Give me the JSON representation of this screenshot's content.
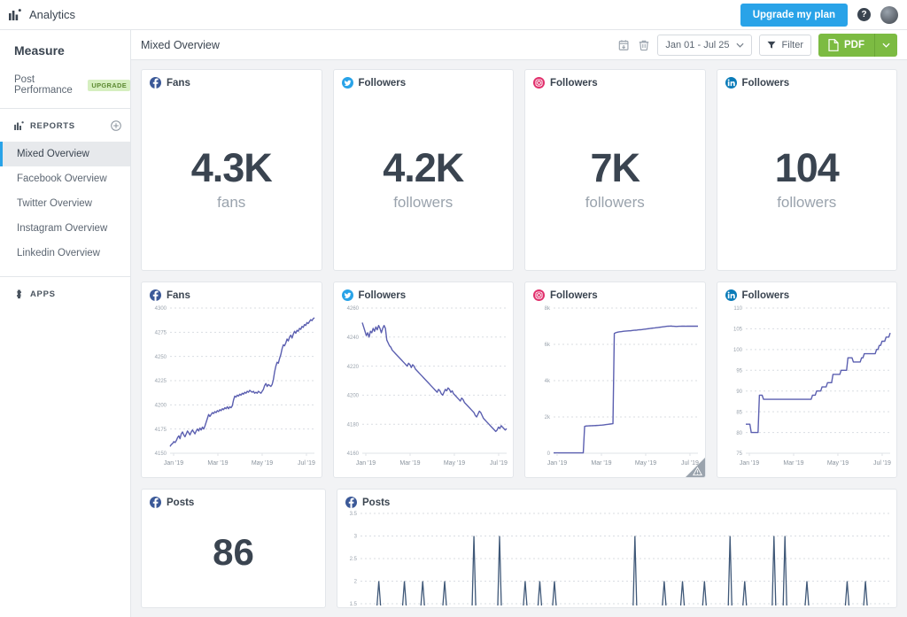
{
  "topbar": {
    "brand": "Analytics",
    "upgrade_label": "Upgrade my plan",
    "help_label": "?"
  },
  "sidebar": {
    "measure_title": "Measure",
    "post_performance": {
      "label": "Post Performance",
      "badge": "UPGRADE"
    },
    "reports_header": "REPORTS",
    "reports": [
      {
        "label": "Mixed Overview",
        "active": true
      },
      {
        "label": "Facebook Overview",
        "active": false
      },
      {
        "label": "Twitter Overview",
        "active": false
      },
      {
        "label": "Instagram Overview",
        "active": false
      },
      {
        "label": "Linkedin Overview",
        "active": false
      }
    ],
    "apps_header": "APPS"
  },
  "toolbar": {
    "title": "Mixed Overview",
    "date_range": "Jan 01 - Jul 25",
    "filter_label": "Filter",
    "pdf_label": "PDF"
  },
  "colors": {
    "facebook": "#3b5998",
    "twitter": "#29a3e8",
    "instagram": "#e1306c",
    "linkedin": "#0a7bb8",
    "accent_blue": "#29a3e8",
    "accent_green": "#7cbb42",
    "line_purple": "#5b5fb0",
    "spike_blue": "#3f5878"
  },
  "summary_cards": [
    {
      "network": "facebook",
      "title": "Fans",
      "value": "4.3K",
      "unit": "fans"
    },
    {
      "network": "twitter",
      "title": "Followers",
      "value": "4.2K",
      "unit": "followers"
    },
    {
      "network": "instagram",
      "title": "Followers",
      "value": "7K",
      "unit": "followers"
    },
    {
      "network": "linkedin",
      "title": "Followers",
      "value": "104",
      "unit": "followers"
    }
  ],
  "bottom_cards": [
    {
      "network": "facebook",
      "title": "Posts",
      "value": "86"
    },
    {
      "network": "facebook",
      "title": "Posts"
    }
  ],
  "chart_data": [
    {
      "id": "facebook-fans",
      "type": "line",
      "title": "Fans",
      "network": "facebook",
      "ylabel": "",
      "xlabel": "",
      "ylim": [
        4150,
        4300
      ],
      "yticks": [
        4150,
        4175,
        4200,
        4225,
        4250,
        4275,
        4300
      ],
      "xticks": [
        "Jan '19",
        "Mar '19",
        "May '19",
        "Jul '19"
      ],
      "grid": true,
      "values": [
        4157,
        4159,
        4160,
        4162,
        4161,
        4163,
        4166,
        4168,
        4165,
        4170,
        4172,
        4169,
        4167,
        4170,
        4173,
        4171,
        4169,
        4172,
        4174,
        4172,
        4170,
        4173,
        4175,
        4173,
        4176,
        4174,
        4177,
        4175,
        4178,
        4182,
        4186,
        4190,
        4188,
        4190,
        4192,
        4191,
        4193,
        4192,
        4194,
        4193,
        4195,
        4194,
        4196,
        4195,
        4197,
        4196,
        4198,
        4196,
        4198,
        4197,
        4199,
        4205,
        4209,
        4208,
        4210,
        4209,
        4211,
        4210,
        4212,
        4211,
        4213,
        4212,
        4214,
        4213,
        4215,
        4214,
        4213,
        4214,
        4212,
        4213,
        4212,
        4214,
        4213,
        4212,
        4214,
        4216,
        4220,
        4222,
        4219,
        4221,
        4220,
        4219,
        4221,
        4226,
        4234,
        4240,
        4244,
        4243,
        4248,
        4252,
        4258,
        4262,
        4261,
        4264,
        4268,
        4266,
        4270,
        4272,
        4269,
        4273,
        4276,
        4274,
        4277,
        4276,
        4279,
        4278,
        4281,
        4280,
        4283,
        4282,
        4285,
        4284,
        4286,
        4288,
        4287,
        4289,
        4290
      ]
    },
    {
      "id": "twitter-followers",
      "type": "line",
      "title": "Followers",
      "network": "twitter",
      "ylim": [
        4160,
        4260
      ],
      "yticks": [
        4160,
        4180,
        4200,
        4220,
        4240,
        4260
      ],
      "xticks": [
        "Jan '19",
        "Mar '19",
        "May '19",
        "Jul '19"
      ],
      "grid": true,
      "values": [
        4250,
        4247,
        4244,
        4241,
        4243,
        4240,
        4244,
        4243,
        4246,
        4244,
        4247,
        4245,
        4248,
        4246,
        4243,
        4246,
        4248,
        4246,
        4238,
        4236,
        4234,
        4233,
        4231,
        4230,
        4229,
        4228,
        4227,
        4226,
        4225,
        4224,
        4223,
        4222,
        4221,
        4220,
        4222,
        4221,
        4219,
        4221,
        4220,
        4218,
        4217,
        4216,
        4215,
        4214,
        4213,
        4212,
        4211,
        4210,
        4209,
        4208,
        4207,
        4206,
        4205,
        4204,
        4203,
        4202,
        4204,
        4203,
        4201,
        4200,
        4202,
        4204,
        4203,
        4205,
        4204,
        4202,
        4203,
        4201,
        4200,
        4199,
        4198,
        4197,
        4196,
        4198,
        4197,
        4195,
        4194,
        4193,
        4192,
        4191,
        4190,
        4189,
        4188,
        4186,
        4185,
        4187,
        4189,
        4188,
        4186,
        4184,
        4183,
        4182,
        4181,
        4180,
        4179,
        4178,
        4177,
        4176,
        4175,
        4176,
        4178,
        4177,
        4179,
        4178,
        4177,
        4176,
        4177
      ]
    },
    {
      "id": "instagram-followers",
      "type": "line",
      "title": "Followers",
      "network": "instagram",
      "ylim": [
        0,
        8000
      ],
      "yticks": [
        0,
        2000,
        4000,
        6000,
        8000
      ],
      "ytick_labels": [
        "0",
        "2k",
        "4k",
        "6k",
        "8k"
      ],
      "xticks": [
        "Jan '19",
        "Mar '19",
        "May '19",
        "Jul '19"
      ],
      "grid": true,
      "has_resize_handle": true,
      "values": [
        20,
        20,
        20,
        20,
        20,
        20,
        20,
        20,
        20,
        20,
        20,
        20,
        20,
        20,
        20,
        20,
        20,
        20,
        20,
        20,
        20,
        20,
        20,
        1480,
        1500,
        1505,
        1510,
        1512,
        1515,
        1518,
        1520,
        1525,
        1530,
        1535,
        1540,
        1545,
        1550,
        1560,
        1570,
        1580,
        1590,
        1600,
        1610,
        1620,
        1630,
        6600,
        6640,
        6660,
        6680,
        6690,
        6700,
        6710,
        6720,
        6730,
        6735,
        6740,
        6745,
        6750,
        6760,
        6770,
        6775,
        6780,
        6790,
        6800,
        6805,
        6810,
        6820,
        6830,
        6840,
        6850,
        6860,
        6870,
        6880,
        6890,
        6900,
        6905,
        6915,
        6925,
        6935,
        6945,
        6955,
        6965,
        6975,
        6985,
        6995,
        7000,
        7005,
        7010,
        7000,
        6995,
        6990,
        6985,
        6990,
        6995,
        6998,
        7000,
        7002,
        7000,
        6998,
        7000,
        7002,
        7000,
        7001,
        7000,
        7002,
        7000,
        7001,
        7000
      ]
    },
    {
      "id": "linkedin-followers",
      "type": "line",
      "title": "Followers",
      "network": "linkedin",
      "ylim": [
        75,
        110
      ],
      "yticks": [
        75,
        80,
        85,
        90,
        95,
        100,
        105,
        110
      ],
      "xticks": [
        "Jan '19",
        "Mar '19",
        "May '19",
        "Jul '19"
      ],
      "grid": true,
      "values": [
        82,
        82,
        82,
        82,
        80,
        80,
        80,
        80,
        80,
        80,
        89,
        89,
        89,
        88,
        88,
        88,
        88,
        88,
        88,
        88,
        88,
        88,
        88,
        88,
        88,
        88,
        88,
        88,
        88,
        88,
        88,
        88,
        88,
        88,
        88,
        88,
        88,
        88,
        88,
        88,
        88,
        88,
        88,
        88,
        88,
        88,
        88,
        88,
        88,
        89,
        89,
        89,
        90,
        90,
        90,
        90,
        91,
        91,
        91,
        91,
        92,
        92,
        92,
        92,
        94,
        94,
        94,
        94,
        94,
        94,
        95,
        95,
        95,
        95,
        95,
        98,
        98,
        98,
        98,
        97,
        97,
        97,
        97,
        97,
        97,
        98,
        98,
        99,
        99,
        99,
        99,
        99,
        99,
        99,
        99,
        99,
        100,
        100,
        101,
        101,
        102,
        102,
        102,
        103,
        103,
        103,
        104
      ]
    },
    {
      "id": "facebook-posts",
      "type": "line",
      "title": "Posts",
      "network": "facebook",
      "ylim": [
        1.5,
        3.5
      ],
      "yticks": [
        1.5,
        2,
        2.5,
        3,
        3.5
      ],
      "grid": true,
      "note": "sparse spike series; baseline 1, spikes to 2 or 3",
      "spikes": [
        {
          "x": 5,
          "v": 2
        },
        {
          "x": 12,
          "v": 2
        },
        {
          "x": 17,
          "v": 2
        },
        {
          "x": 23,
          "v": 2
        },
        {
          "x": 31,
          "v": 3
        },
        {
          "x": 38,
          "v": 3
        },
        {
          "x": 45,
          "v": 2
        },
        {
          "x": 49,
          "v": 2
        },
        {
          "x": 53,
          "v": 2
        },
        {
          "x": 75,
          "v": 3
        },
        {
          "x": 83,
          "v": 2
        },
        {
          "x": 88,
          "v": 2
        },
        {
          "x": 94,
          "v": 2
        },
        {
          "x": 101,
          "v": 3
        },
        {
          "x": 105,
          "v": 2
        },
        {
          "x": 113,
          "v": 3
        },
        {
          "x": 116,
          "v": 3
        },
        {
          "x": 122,
          "v": 2
        },
        {
          "x": 133,
          "v": 2
        },
        {
          "x": 138,
          "v": 2
        }
      ]
    }
  ]
}
